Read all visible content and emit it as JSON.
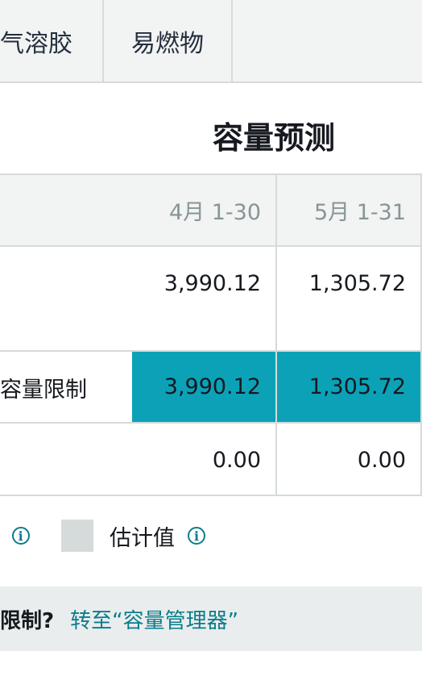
{
  "tabs": [
    {
      "label": "气溶胶"
    },
    {
      "label": "易燃物"
    }
  ],
  "heading": "容量预测",
  "table": {
    "columns": [
      "4月 1-30",
      "5月 1-31"
    ],
    "rows": [
      {
        "label": "",
        "values": [
          "3,990.12",
          "1,305.72"
        ]
      },
      {
        "label": "容量限制",
        "values": [
          "3,990.12",
          "1,305.72"
        ]
      },
      {
        "label": "",
        "values": [
          "0.00",
          "0.00"
        ]
      }
    ]
  },
  "legend": {
    "estimate_label": "估计值",
    "info_glyph": "i"
  },
  "footer": {
    "question": "限制?",
    "link": "转至“容量管理器”"
  },
  "colors": {
    "highlight": "#0ba2b8",
    "link": "#0a7d8c",
    "estimate_swatch": "#d5dbdb"
  }
}
